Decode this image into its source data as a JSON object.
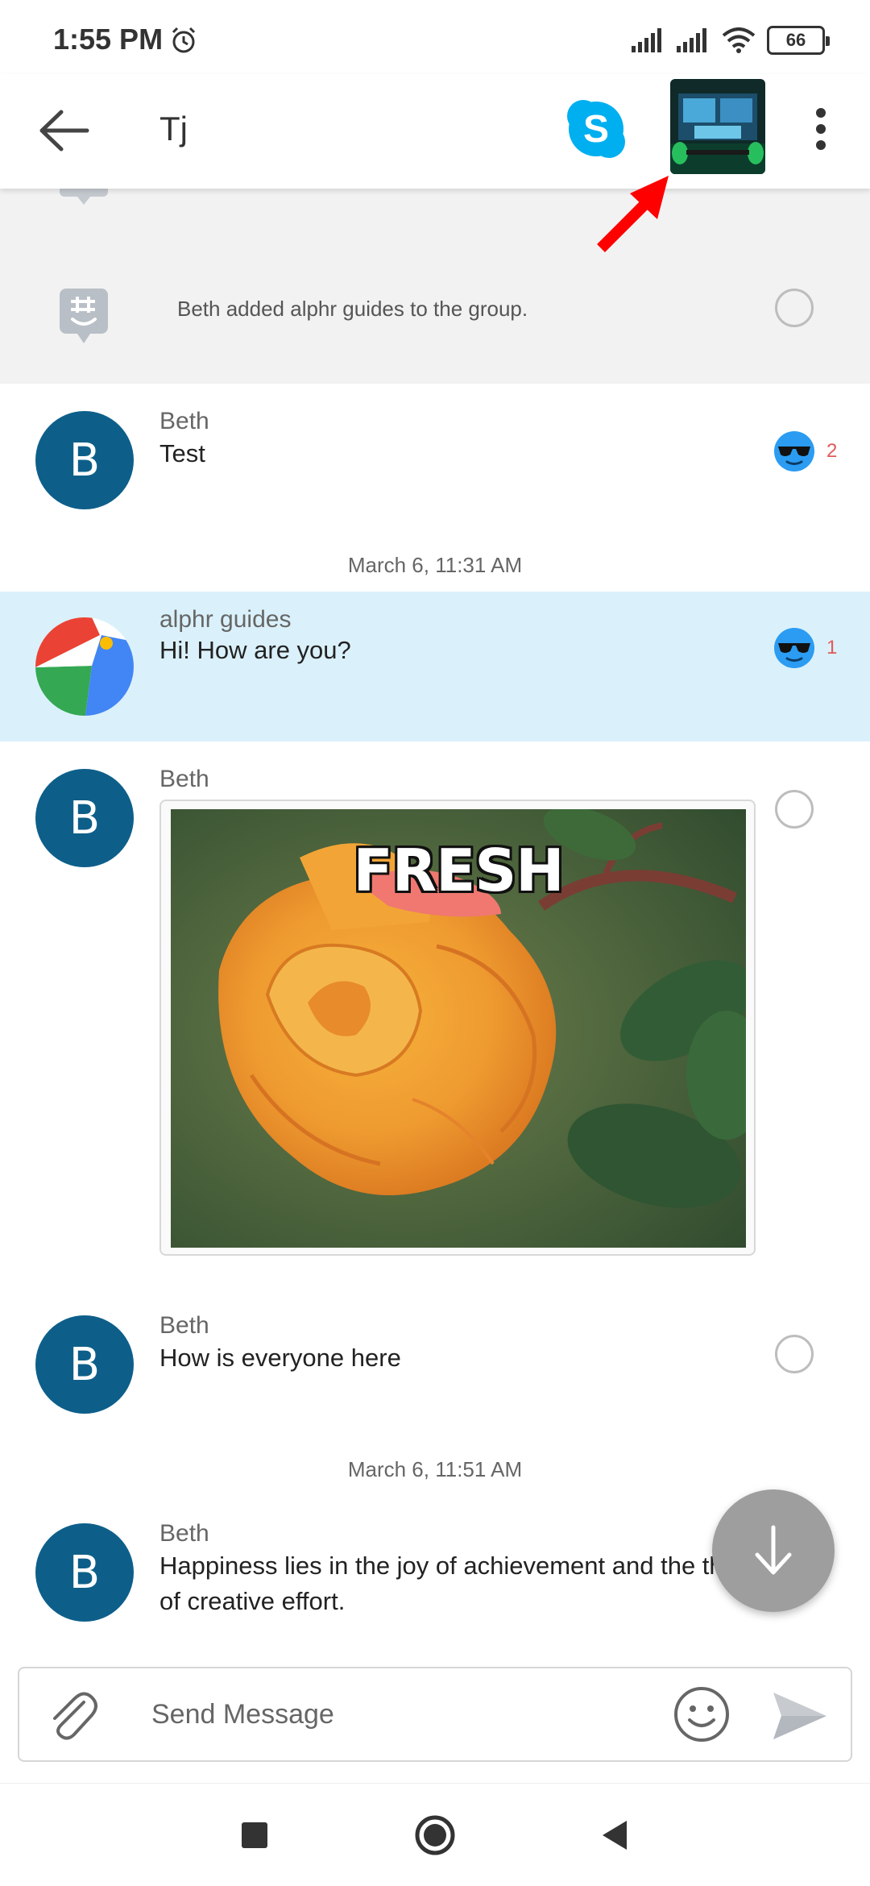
{
  "status_bar": {
    "time": "1:55 PM",
    "battery": "66",
    "icons": [
      "alarm-icon",
      "signal-icon",
      "signal-icon",
      "wifi-icon",
      "battery-icon"
    ]
  },
  "app_bar": {
    "title": "Tj",
    "icons": [
      "back-arrow-icon",
      "skype-icon",
      "group-photo-thumbnail",
      "more-vert-icon"
    ]
  },
  "annotation": {
    "arrow_color": "#ff0000"
  },
  "system_message": {
    "text": "Beth added alphr guides to the group."
  },
  "messages": [
    {
      "sender": "Beth",
      "avatar_letter": "B",
      "text": "Test",
      "reaction_count": "2"
    },
    {
      "sender": "alphr guides",
      "text": "Hi! How are you?",
      "reaction_count": "1"
    },
    {
      "sender": "Beth",
      "avatar_letter": "B",
      "image_caption": "FRESH"
    },
    {
      "sender": "Beth",
      "avatar_letter": "B",
      "text": "How is everyone here"
    },
    {
      "sender": "Beth",
      "avatar_letter": "B",
      "text_line1": "Happiness lies in the joy of achievement and the th",
      "text_line2": "of creative effort."
    }
  ],
  "date_separators": [
    "March 6, 11:31 AM",
    "March 6, 11:51 AM"
  ],
  "composer": {
    "placeholder": "Send Message"
  },
  "colors": {
    "avatar": "#0d5f8a",
    "highlight": "#daf1fb",
    "reaction_count": "#e05a5a",
    "skype": "#00aff0"
  }
}
